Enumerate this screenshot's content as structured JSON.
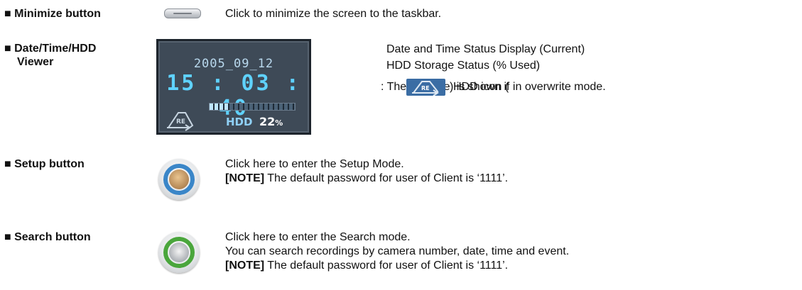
{
  "minimize": {
    "label": "■ Minimize button",
    "desc": "Click to minimize the screen to the taskbar."
  },
  "viewer": {
    "label_line1": "■ Date/Time/HDD",
    "label_line2": "Viewer",
    "date": "2005_09_12",
    "time": "15 : 03 : 40",
    "hdd_label": "HDD",
    "hdd_percent_value": "22",
    "hdd_percent_unit": "%",
    "hdd_used_fraction": 0.22,
    "desc_line1": "Date and Time Status Display (Current)",
    "desc_line2": "HDD Storage Status (% Used)",
    "recycle_before": ": The Recycle HDD icon (",
    "recycle_after": ") is shown if in overwrite mode.",
    "re_icon_text": "RE"
  },
  "setup": {
    "label": "■ Setup button",
    "desc_line1": "Click here to enter the Setup Mode.",
    "note_tag": "[NOTE]",
    "note_text": " The default password for user of Client is ‘1111’.",
    "ring_color": "#3a86c8"
  },
  "search": {
    "label": "■ Search button",
    "desc_line1": "Click here to enter the Search mode.",
    "desc_line2": "You can search recordings by camera number, date, time and event.",
    "note_tag": "[NOTE]",
    "note_text": " The default password for user of Client is ‘1111’.",
    "ring_color": "#4aa63c"
  }
}
